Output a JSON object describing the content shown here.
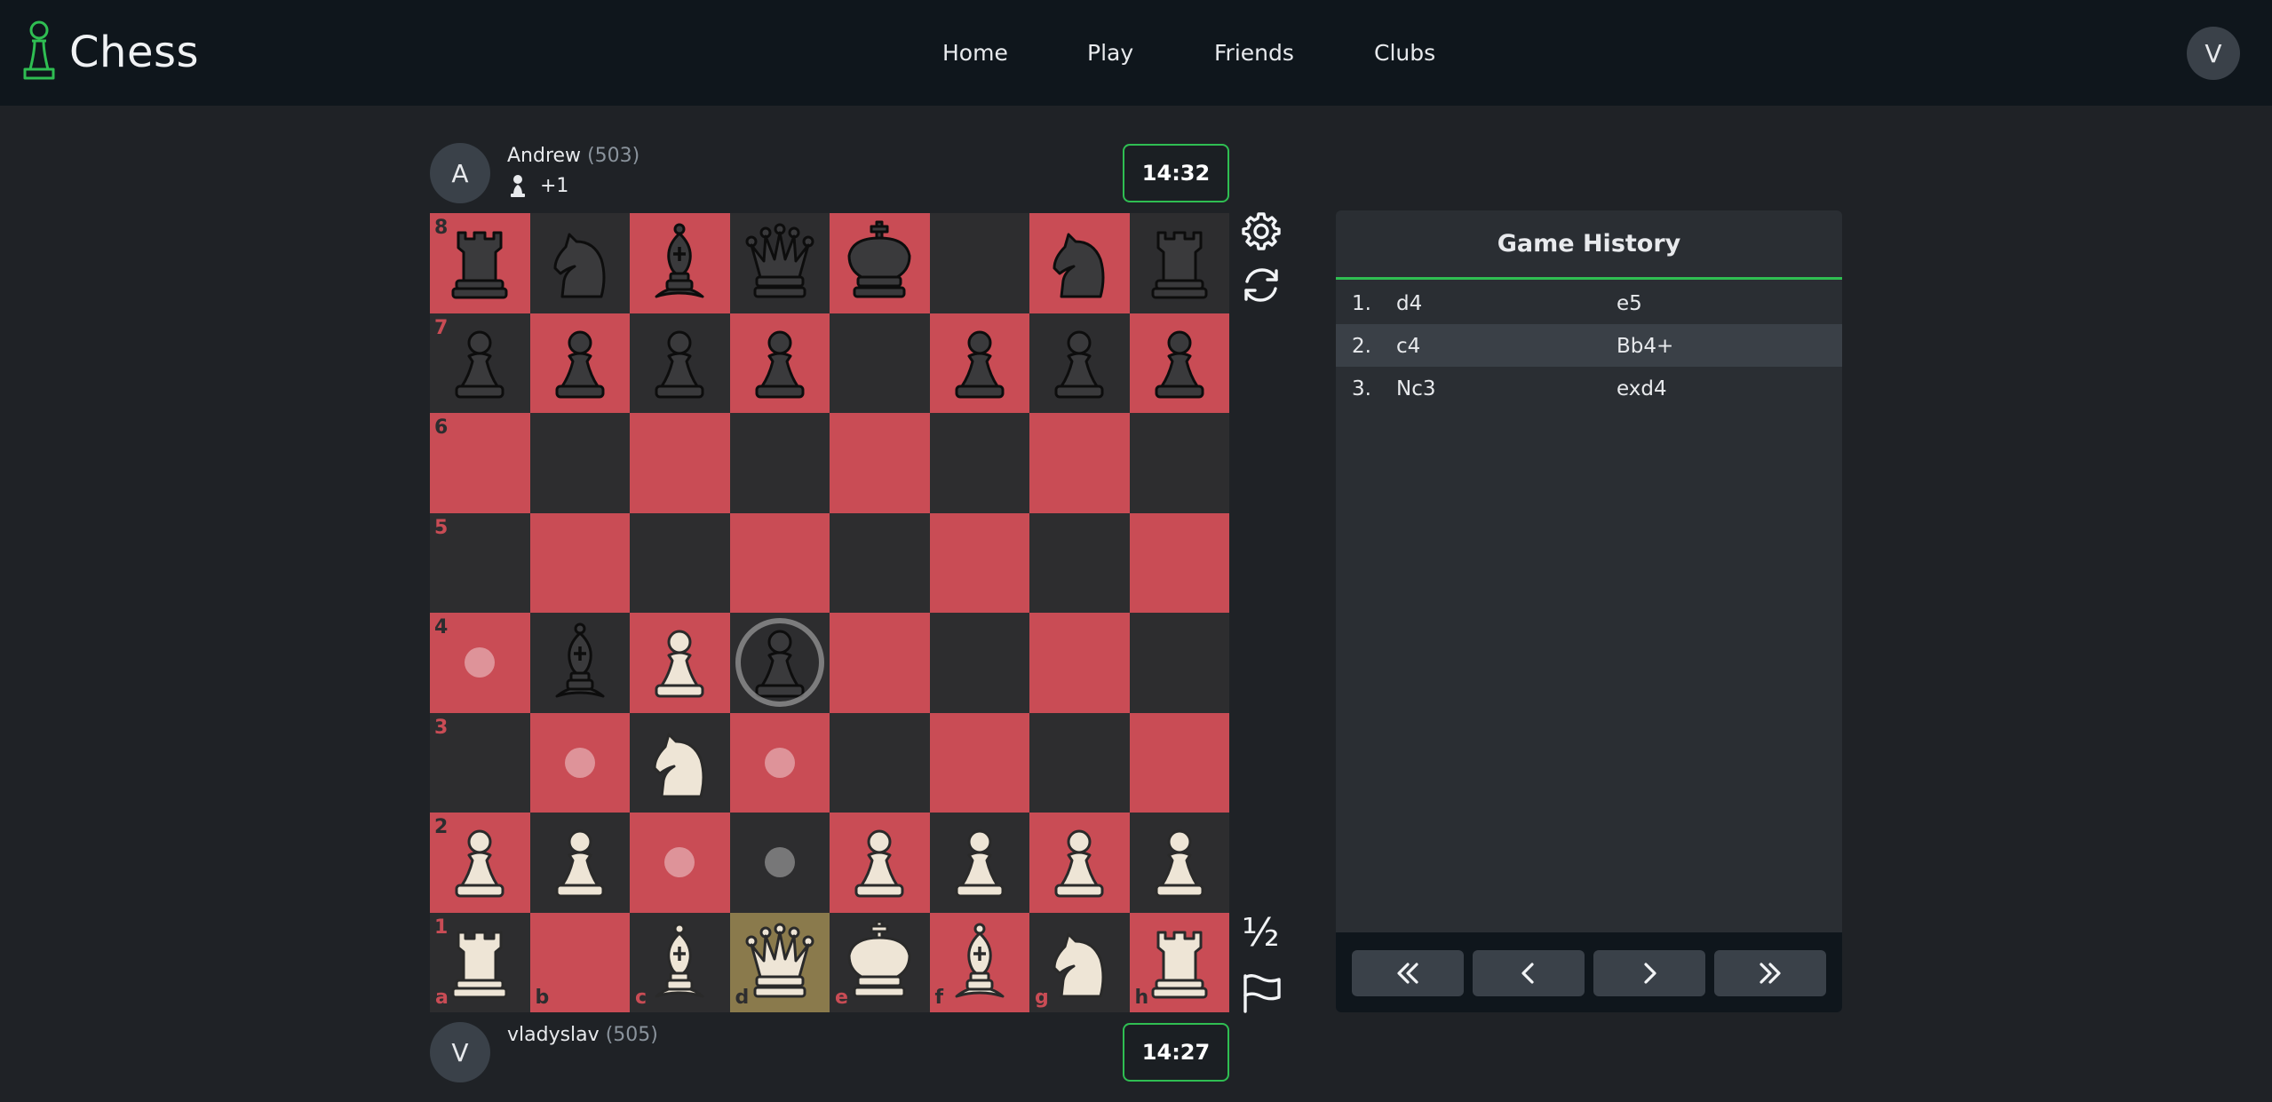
{
  "app": {
    "title": "Chess"
  },
  "nav": {
    "items": [
      "Home",
      "Play",
      "Friends",
      "Clubs"
    ]
  },
  "user": {
    "avatar_initial": "V"
  },
  "opponent": {
    "avatar_initial": "A",
    "name": "Andrew",
    "rating": "(503)",
    "material_advantage": "+1",
    "captured_piece_icon": "pawn-icon",
    "clock": "14:32"
  },
  "player": {
    "avatar_initial": "V",
    "name": "vladyslav",
    "rating": "(505)",
    "clock": "14:27"
  },
  "board": {
    "theme": {
      "light_square": "#c94c55",
      "dark_square": "#2d2d2f",
      "last_move": "#8a7a4c",
      "accent": "#2fbe52"
    },
    "ranks": [
      "8",
      "7",
      "6",
      "5",
      "4",
      "3",
      "2",
      "1"
    ],
    "files": [
      "a",
      "b",
      "c",
      "d",
      "e",
      "f",
      "g",
      "h"
    ],
    "position": [
      [
        "bR",
        "bN",
        "bB",
        "bQ",
        "bK",
        "",
        "bN",
        "bR"
      ],
      [
        "bP",
        "bP",
        "bP",
        "bP",
        "",
        "bP",
        "bP",
        "bP"
      ],
      [
        "",
        "",
        "",
        "",
        "",
        "",
        "",
        ""
      ],
      [
        "",
        "",
        "",
        "",
        "",
        "",
        "",
        ""
      ],
      [
        "",
        "bB",
        "wP",
        "bP",
        "",
        "",
        "",
        ""
      ],
      [
        "",
        "",
        "wN",
        "",
        "",
        "",
        "",
        ""
      ],
      [
        "wP",
        "wP",
        "",
        "",
        "wP",
        "wP",
        "wP",
        "wP"
      ],
      [
        "wR",
        "",
        "wB",
        "wQ",
        "wK",
        "wB",
        "wN",
        "wR"
      ]
    ],
    "selected_square": "d1",
    "move_hints": [
      "a4",
      "b3",
      "d3",
      "c2",
      "d2"
    ],
    "capture_hints": [
      "d4"
    ]
  },
  "controls": {
    "settings_icon": "gear-icon",
    "flip_icon": "flip-board-icon",
    "draw_label": "½",
    "resign_icon": "flag-icon"
  },
  "history": {
    "title": "Game History",
    "moves": [
      {
        "num": "1.",
        "white": "d4",
        "black": "e5"
      },
      {
        "num": "2.",
        "white": "c4",
        "black": "Bb4+"
      },
      {
        "num": "3.",
        "white": "Nc3",
        "black": "exd4"
      }
    ],
    "nav_icons": [
      "first-move-icon",
      "previous-move-icon",
      "next-move-icon",
      "last-move-icon"
    ]
  }
}
